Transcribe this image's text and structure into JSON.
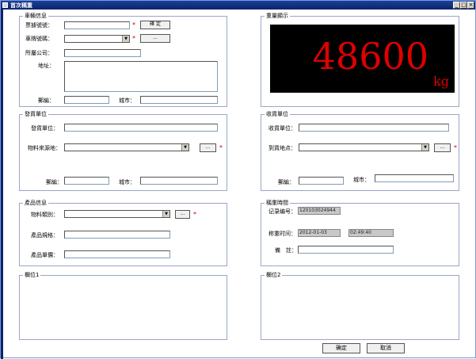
{
  "window": {
    "title": "首次稱重",
    "min_btn": "_",
    "max_btn": "□",
    "close_btn": "×"
  },
  "vehicle": {
    "title": "車輛信息",
    "card_no_label": "票據號號：",
    "confirm_button": "確 定",
    "plate_label": "車牌號碼：",
    "plate_more_button": "...",
    "company_label": "所屬公司：",
    "address_label": "地址：",
    "postcode_label": "郵編：",
    "city_label": "城市："
  },
  "weight_display": {
    "title": "重量顯示",
    "value": "48600",
    "unit": "kg"
  },
  "shipper": {
    "title": "發貨單位",
    "unit_label": "發貨單位：",
    "source_label": "物料來源地：",
    "source_more_button": "...",
    "postcode_label": "郵編：",
    "city_label": "城市："
  },
  "receiver": {
    "title": "收貨單位",
    "unit_label": "收貨單位：",
    "dest_label": "到貨地点：",
    "dest_more_button": "...",
    "postcode_label": "郵編：",
    "city_label": "城市："
  },
  "product": {
    "title": "產品信息",
    "category_label": "物料類別：",
    "category_more_button": "...",
    "spec_label": "產品規格：",
    "price_label": "產品單價："
  },
  "weigh_time": {
    "title": "稱重時間",
    "record_label": "记录编号：",
    "record_value": "120103024944",
    "time_label": "称重时间：",
    "date_value": "2012-01-03",
    "clock_value": "02:49:40",
    "remark_label": "備　註："
  },
  "field1": {
    "title": "欄位1"
  },
  "field2": {
    "title": "欄位2"
  },
  "actions": {
    "ok": "确定",
    "cancel": "取消"
  },
  "required_mark": "*",
  "colors": {
    "titlebar": "#0a246a",
    "display_bg": "#000000",
    "display_fg": "#e00000",
    "required": "#d00000"
  }
}
